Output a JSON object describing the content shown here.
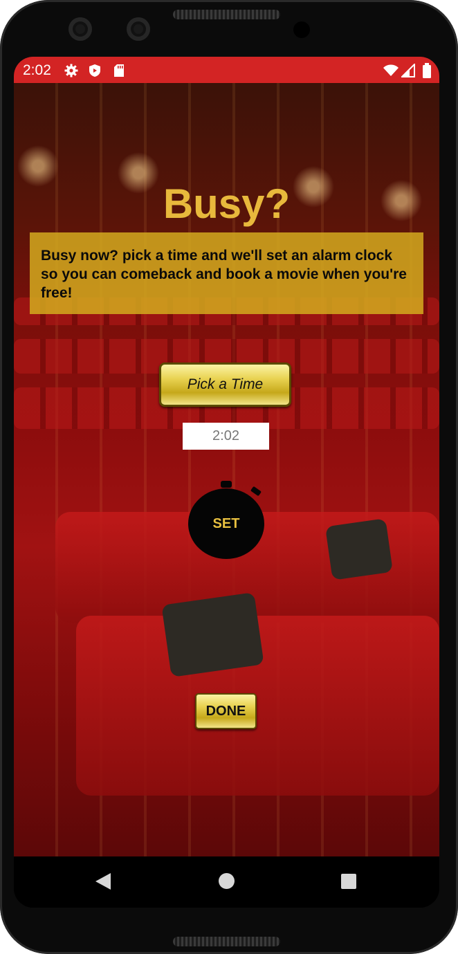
{
  "status_bar": {
    "time": "2:02",
    "left_icons": [
      "gear-icon",
      "shield-icon",
      "sd-card-icon"
    ],
    "right_icons": [
      "wifi-icon",
      "signal-icon",
      "battery-icon"
    ],
    "color": "#d32424"
  },
  "screen": {
    "title": "Busy?",
    "info_text": "Busy now? pick a time and we'll set an alarm clock so you can comeback and book a movie when you're free!",
    "pick_time_button": "Pick a Time",
    "selected_time": "2:02",
    "set_button": "SET",
    "done_button": "DONE"
  },
  "colors": {
    "title": "#e8b93c",
    "info_box": "#d4aa1e",
    "set_label": "#e8c040"
  },
  "nav_bar": {
    "buttons": [
      "back-icon",
      "home-icon",
      "recents-icon"
    ]
  }
}
